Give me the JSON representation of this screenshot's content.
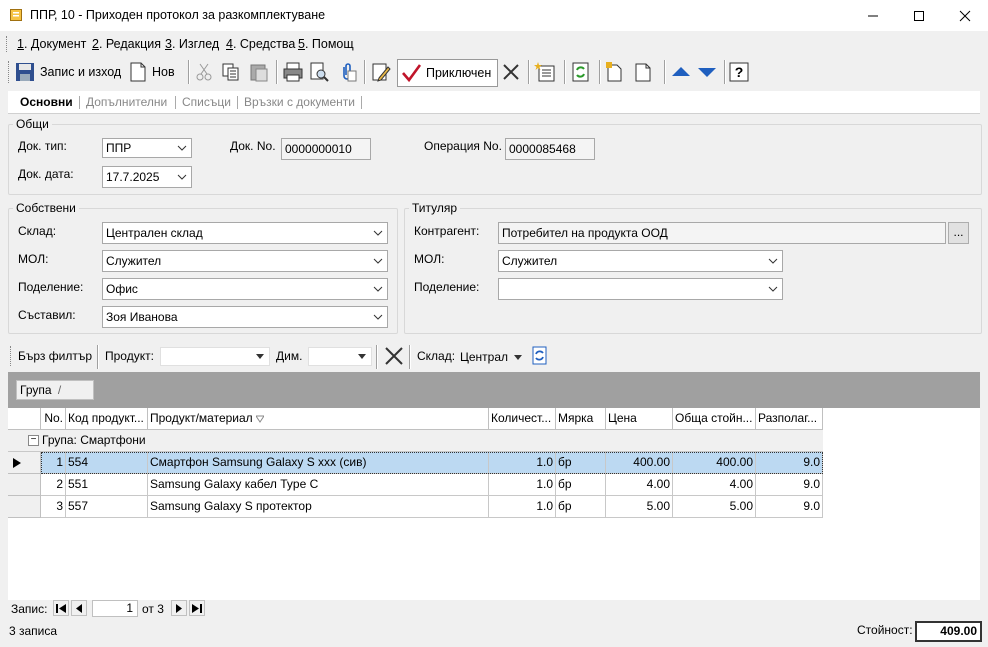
{
  "window": {
    "title": "ППР, 10 - Приходен протокол за разкомплектуване"
  },
  "menu": [
    {
      "key": "1",
      "label": ". Документ"
    },
    {
      "key": "2",
      "label": ". Редакция"
    },
    {
      "key": "3",
      "label": ". Изглед"
    },
    {
      "key": "4",
      "label": ". Средства"
    },
    {
      "key": "5",
      "label": ". Помощ"
    }
  ],
  "toolbar": {
    "save_exit": "Запис и изход",
    "new": "Нов",
    "done": "Приключен"
  },
  "tabs": [
    "Основни",
    "Допълнителни",
    "Списъци",
    "Връзки с документи"
  ],
  "general": {
    "title": "Общи",
    "doc_type_label": "Док. тип:",
    "doc_type": "ППР",
    "doc_no_label": "Док. No.",
    "doc_no": "0000000010",
    "op_no_label": "Операция No.",
    "op_no": "0000085468",
    "doc_date_label": "Док. дата:",
    "doc_date": "17.7.2025"
  },
  "own": {
    "title": "Собствени",
    "warehouse_label": "Склад:",
    "warehouse": "Централен склад",
    "mol_label": "МОЛ:",
    "mol": "Служител",
    "division_label": "Поделение:",
    "division": "Офис",
    "author_label": "Съставил:",
    "author": "Зоя Иванова"
  },
  "holder": {
    "title": "Титуляр",
    "partner_label": "Контрагент:",
    "partner": "Потребител на продукта ООД",
    "partner_btn": "...",
    "mol_label": "МОЛ:",
    "mol": "Служител",
    "division_label": "Поделение:",
    "division": ""
  },
  "filter": {
    "quick": "Бърз филтър",
    "product_label": "Продукт:",
    "product": "",
    "dim_label": "Дим.",
    "dim": "",
    "warehouse_label": "Склад:",
    "warehouse": "Централ"
  },
  "grid": {
    "group_chip": "Група",
    "group_chip_mark": "/",
    "columns": [
      "No.",
      "Код продукт...",
      "Продукт/материал",
      "Количест...",
      "Мярка",
      "Цена",
      "Обща стойн...",
      "Разполаг..."
    ],
    "group_row": "Група: Смартфони",
    "group_toggle": "−",
    "rows": [
      {
        "no": "1",
        "code": "554",
        "name": "Смартфон Samsung Galaxy S  xxx (сив)",
        "qty": "1.0",
        "unit": "бр",
        "price": "400.00",
        "total": "400.00",
        "avail": "9.0"
      },
      {
        "no": "2",
        "code": "551",
        "name": "Samsung Galaxy кабел Type C",
        "qty": "1.0",
        "unit": "бр",
        "price": "4.00",
        "total": "4.00",
        "avail": "9.0"
      },
      {
        "no": "3",
        "code": "557",
        "name": "Samsung Galaxy S протектор",
        "qty": "1.0",
        "unit": "бр",
        "price": "5.00",
        "total": "5.00",
        "avail": "9.0"
      }
    ]
  },
  "nav": {
    "label": "Запис:",
    "current": "1",
    "of": "от 3"
  },
  "status": {
    "records": "3 записа",
    "value_label": "Стойност:",
    "value": "409.00"
  },
  "colors": {
    "selected_row": "#bcd9f2",
    "group_band": "#a0a0a0",
    "accent_blue": "#1f5fbf"
  }
}
